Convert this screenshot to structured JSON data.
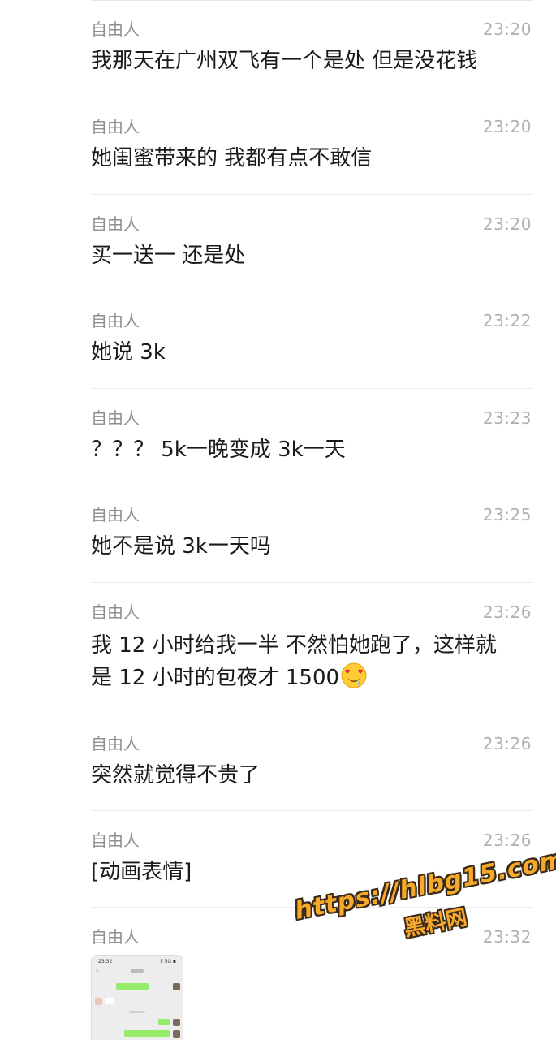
{
  "messages": [
    {
      "sender": "自由人",
      "time": "23:20",
      "text": "我那天在广州双飞有一个是处 但是没花钱"
    },
    {
      "sender": "自由人",
      "time": "23:20",
      "text": "她闺蜜带来的 我都有点不敢信"
    },
    {
      "sender": "自由人",
      "time": "23:20",
      "text": "买一送一 还是处"
    },
    {
      "sender": "自由人",
      "time": "23:22",
      "text": "她说 3k"
    },
    {
      "sender": "自由人",
      "time": "23:23",
      "text": "？？？  5k一晚变成 3k一天"
    },
    {
      "sender": "自由人",
      "time": "23:25",
      "text": "她不是说 3k一天吗"
    },
    {
      "sender": "自由人",
      "time": "23:26",
      "text_line1": "我 12 小时给我一半 不然怕她跑了，这样就",
      "text_line2": "是 12 小时的包夜才 1500",
      "emoji": "heart-eyes-drool-emoji"
    },
    {
      "sender": "自由人",
      "time": "23:26",
      "text": "突然就觉得不贵了"
    },
    {
      "sender": "自由人",
      "time": "23:26",
      "text": "[动画表情]"
    },
    {
      "sender": "自由人",
      "time": "23:32",
      "attachment": "chat-screenshot-image"
    }
  ],
  "thumbnail": {
    "status_time": "23:32",
    "status_right": "ll 5G ▪",
    "back": "‹"
  },
  "watermark": {
    "url": "https://hlbg15.com",
    "cn": "黑料网",
    "color": "#f7a92a"
  }
}
